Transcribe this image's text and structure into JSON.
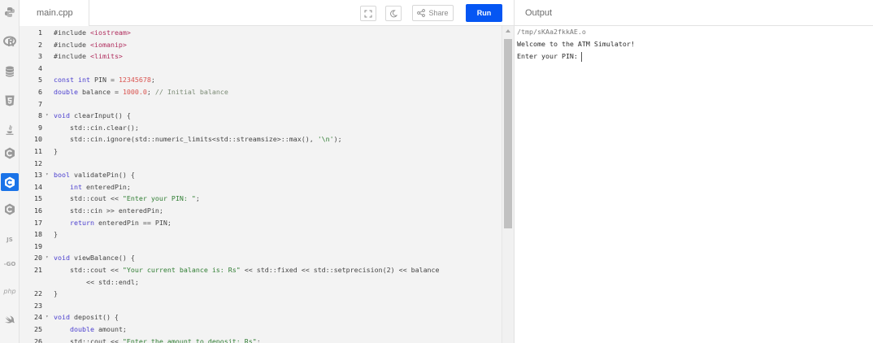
{
  "sidebar": {
    "items": [
      {
        "icon": "python-icon"
      },
      {
        "icon": "r-icon"
      },
      {
        "icon": "database-icon"
      },
      {
        "icon": "html5-icon"
      },
      {
        "icon": "java-icon"
      },
      {
        "icon": "c-icon"
      },
      {
        "icon": "cpp-icon",
        "active": true
      },
      {
        "icon": "csharp-icon"
      },
      {
        "icon": "js-icon",
        "label": "JS"
      },
      {
        "icon": "go-icon",
        "label": "-GO"
      },
      {
        "icon": "php-icon",
        "label": "php"
      },
      {
        "icon": "swift-icon"
      }
    ]
  },
  "editor": {
    "file_name": "main.cpp",
    "share_label": "Share",
    "run_label": "Run",
    "accent_color": "#0556f3",
    "lines": [
      {
        "n": "1",
        "fold": false,
        "tokens": [
          [
            "t",
            "#include "
          ],
          [
            "inc",
            "<iostream>"
          ]
        ]
      },
      {
        "n": "2",
        "fold": false,
        "tokens": [
          [
            "t",
            "#include "
          ],
          [
            "inc",
            "<iomanip>"
          ]
        ]
      },
      {
        "n": "3",
        "fold": false,
        "tokens": [
          [
            "t",
            "#include "
          ],
          [
            "inc",
            "<limits>"
          ]
        ]
      },
      {
        "n": "4",
        "fold": false,
        "tokens": []
      },
      {
        "n": "5",
        "fold": false,
        "tokens": [
          [
            "kw",
            "const int"
          ],
          [
            "t",
            " PIN = "
          ],
          [
            "num",
            "12345678"
          ],
          [
            "t",
            ";"
          ]
        ]
      },
      {
        "n": "6",
        "fold": false,
        "tokens": [
          [
            "kw",
            "double"
          ],
          [
            "t",
            " balance = "
          ],
          [
            "num",
            "1000.0"
          ],
          [
            "t",
            "; "
          ],
          [
            "cm",
            "// Initial balance"
          ]
        ]
      },
      {
        "n": "7",
        "fold": false,
        "tokens": []
      },
      {
        "n": "8",
        "fold": true,
        "tokens": [
          [
            "kw",
            "void"
          ],
          [
            "t",
            " clearInput() {"
          ]
        ]
      },
      {
        "n": "9",
        "fold": false,
        "tokens": [
          [
            "t",
            "    std::cin.clear();"
          ]
        ]
      },
      {
        "n": "10",
        "fold": false,
        "tokens": [
          [
            "t",
            "    std::cin.ignore(std::numeric_limits<std::streamsize>::max(), "
          ],
          [
            "str",
            "'\\n'"
          ],
          [
            "t",
            ");"
          ]
        ]
      },
      {
        "n": "11",
        "fold": false,
        "tokens": [
          [
            "t",
            "}"
          ]
        ]
      },
      {
        "n": "12",
        "fold": false,
        "tokens": []
      },
      {
        "n": "13",
        "fold": true,
        "tokens": [
          [
            "kw",
            "bool"
          ],
          [
            "t",
            " validatePin() {"
          ]
        ]
      },
      {
        "n": "14",
        "fold": false,
        "tokens": [
          [
            "t",
            "    "
          ],
          [
            "kw",
            "int"
          ],
          [
            "t",
            " enteredPin;"
          ]
        ]
      },
      {
        "n": "15",
        "fold": false,
        "tokens": [
          [
            "t",
            "    std::cout << "
          ],
          [
            "str",
            "\"Enter your PIN: \""
          ],
          [
            "t",
            ";"
          ]
        ]
      },
      {
        "n": "16",
        "fold": false,
        "tokens": [
          [
            "t",
            "    std::cin >> enteredPin;"
          ]
        ]
      },
      {
        "n": "17",
        "fold": false,
        "tokens": [
          [
            "t",
            "    "
          ],
          [
            "kw",
            "return"
          ],
          [
            "t",
            " enteredPin == PIN;"
          ]
        ]
      },
      {
        "n": "18",
        "fold": false,
        "tokens": [
          [
            "t",
            "}"
          ]
        ]
      },
      {
        "n": "19",
        "fold": false,
        "tokens": []
      },
      {
        "n": "20",
        "fold": true,
        "tokens": [
          [
            "kw",
            "void"
          ],
          [
            "t",
            " viewBalance() {"
          ]
        ]
      },
      {
        "n": "21",
        "fold": false,
        "tokens": [
          [
            "t",
            "    std::cout << "
          ],
          [
            "str",
            "\"Your current balance is: Rs\""
          ],
          [
            "t",
            " << std::fixed << std::setprecision(2) << balance"
          ]
        ]
      },
      {
        "n": "",
        "fold": false,
        "tokens": [
          [
            "t",
            "        << std::endl;"
          ]
        ]
      },
      {
        "n": "22",
        "fold": false,
        "tokens": [
          [
            "t",
            "}"
          ]
        ]
      },
      {
        "n": "23",
        "fold": false,
        "tokens": []
      },
      {
        "n": "24",
        "fold": true,
        "tokens": [
          [
            "kw",
            "void"
          ],
          [
            "t",
            " deposit() {"
          ]
        ]
      },
      {
        "n": "25",
        "fold": false,
        "tokens": [
          [
            "t",
            "    "
          ],
          [
            "kw",
            "double"
          ],
          [
            "t",
            " amount;"
          ]
        ]
      },
      {
        "n": "26",
        "fold": false,
        "tokens": [
          [
            "t",
            "    std::cout << "
          ],
          [
            "str",
            "\"Enter the amount to deposit: Rs\""
          ],
          [
            "t",
            ";"
          ]
        ]
      }
    ]
  },
  "output": {
    "title": "Output",
    "lines": [
      {
        "text": "/tmp/sKAa2fkkAE.o",
        "kind": "path"
      },
      {
        "text": "Welcome to the ATM Simulator!",
        "kind": "text"
      },
      {
        "text": "Enter your PIN:",
        "kind": "prompt"
      }
    ]
  }
}
